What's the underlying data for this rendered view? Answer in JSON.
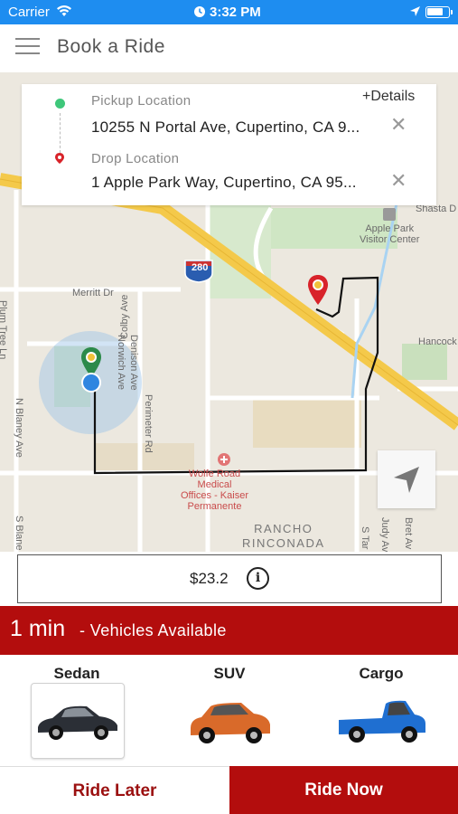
{
  "status_bar": {
    "carrier": "Carrier",
    "time": "3:32 PM",
    "battery_level": 0.8,
    "color": "#1e8df0"
  },
  "header": {
    "title": "Book a Ride",
    "menu_icon": "hamburger-menu-icon"
  },
  "map": {
    "labels": {
      "highway": "280",
      "merritt": "Merritt Dr",
      "norwich": "Norwich Ave",
      "colby": "Colby Ave",
      "denison": "Denison Ave",
      "perimeter": "Perimeter Rd",
      "plum_tree": "Plum Tree Ln",
      "blaney": "N Blaney Ave",
      "s_blaney": "S Blane",
      "apple_park": "Apple Park\nVisitor Center",
      "shasta": "Shasta D",
      "hancock": "Hancock",
      "wolfe_road": "Wolfe Road\nMedical\nOffices - Kaiser\nPermanente",
      "rancho": "RANCHO\nRINCONADA",
      "s_tantau": "S Tar",
      "judy": "Judy Av",
      "bret": "Bret Av"
    }
  },
  "location_card": {
    "details_link": "+Details",
    "pickup_label": "Pickup Location",
    "pickup_value": "10255 N Portal Ave, Cupertino, CA 9...",
    "drop_label": "Drop Location",
    "drop_value": "1 Apple Park Way, Cupertino, CA 95...",
    "clear_symbol": "✕"
  },
  "fare": {
    "amount": "$23.2",
    "info_symbol": "i"
  },
  "eta": {
    "time": "1 min",
    "text": "- Vehicles Available",
    "color": "#b30d0d"
  },
  "vehicles": [
    {
      "name": "Sedan",
      "selected": true,
      "color": "#2b2f36"
    },
    {
      "name": "SUV",
      "selected": false,
      "color": "#d96a2a"
    },
    {
      "name": "Cargo",
      "selected": false,
      "color": "#1f6fd1"
    }
  ],
  "actions": {
    "ride_later": "Ride Later",
    "ride_now": "Ride Now"
  }
}
